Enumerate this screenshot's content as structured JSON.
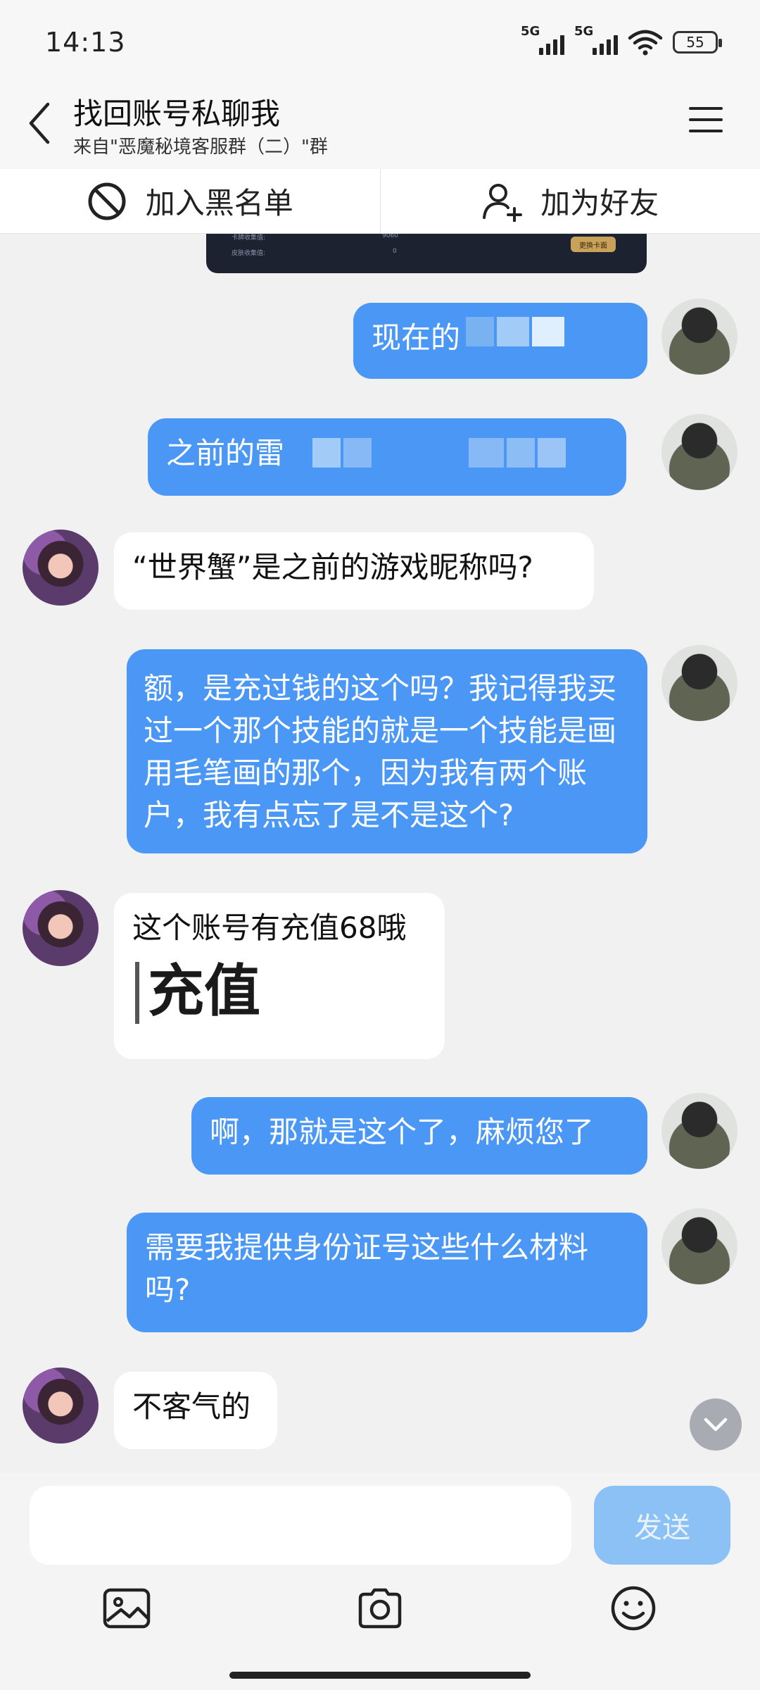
{
  "status_bar": {
    "time": "14:13",
    "signal1_label": "5G",
    "signal2_label": "5G",
    "battery": "55"
  },
  "header": {
    "title": "找回账号私聊我",
    "subtitle": "来自\"恶魔秘境客服群（二）\"群"
  },
  "actions": {
    "blacklist_label": "加入黑名单",
    "add_friend_label": "加为好友"
  },
  "screenshot_fragment": {
    "row1_label": "卡牌收集值:",
    "row1_value": "9060",
    "row2_label": "皮肤收集值:",
    "row2_value": "0",
    "button": "更换卡面"
  },
  "messages": [
    {
      "sender": "me",
      "text": "现在的"
    },
    {
      "sender": "me",
      "text": "之前的雷"
    },
    {
      "sender": "them",
      "text": "“世界蟹”是之前的游戏昵称吗?"
    },
    {
      "sender": "me",
      "text": "额，是充过钱的这个吗？我记得我买过一个那个技能的就是一个技能是画用毛笔画的那个，因为我有两个账户，我有点忘了是不是这个?"
    },
    {
      "sender": "them",
      "text": "这个账号有充值68哦",
      "image_text": "充值"
    },
    {
      "sender": "me",
      "text": "啊，那就是这个了，麻烦您了"
    },
    {
      "sender": "me",
      "text": "需要我提供身份证号这些什么材料吗?"
    },
    {
      "sender": "them",
      "text": "不客气的"
    }
  ],
  "input": {
    "value": "",
    "placeholder": "",
    "send_label": "发送"
  },
  "colors": {
    "me_bubble": "#4a97f5",
    "them_bubble": "#ffffff",
    "send_disabled": "#8cc1f5"
  },
  "icons": [
    "back-arrow-icon",
    "menu-icon",
    "block-icon",
    "add-user-icon",
    "chevron-down-icon",
    "image-icon",
    "camera-icon",
    "emoji-icon"
  ]
}
